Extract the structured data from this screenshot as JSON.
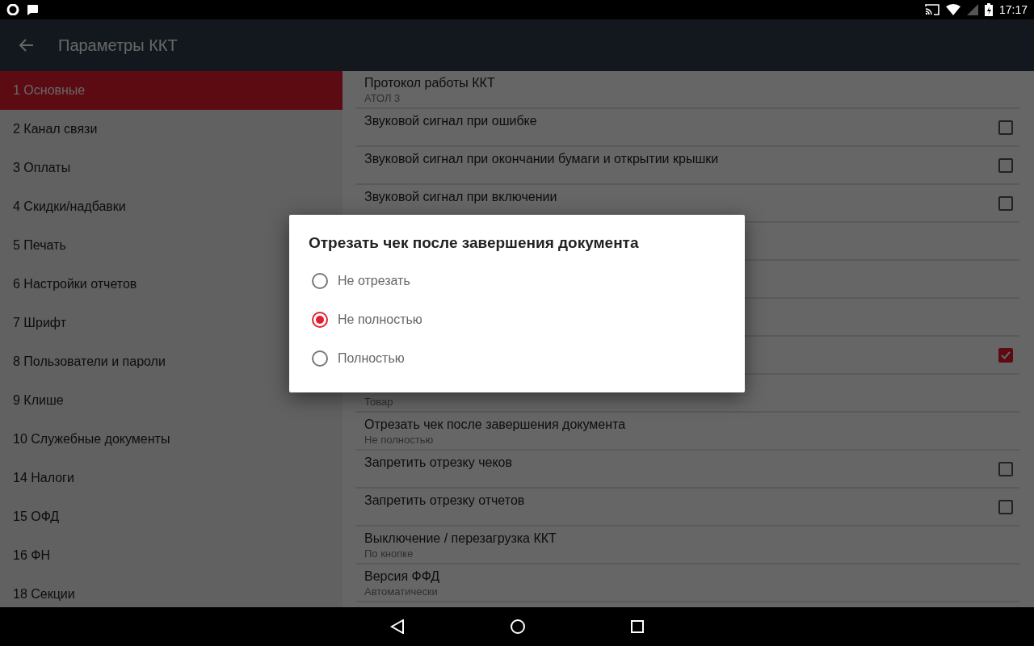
{
  "status_bar": {
    "time": "17:17"
  },
  "app_bar": {
    "title": "Параметры ККТ"
  },
  "sidebar": {
    "items": [
      {
        "label": "1 Основные",
        "selected": true
      },
      {
        "label": "2 Канал связи",
        "selected": false
      },
      {
        "label": "3 Оплаты",
        "selected": false
      },
      {
        "label": "4 Скидки/надбавки",
        "selected": false
      },
      {
        "label": "5 Печать",
        "selected": false
      },
      {
        "label": "6 Настройки отчетов",
        "selected": false
      },
      {
        "label": "7 Шрифт",
        "selected": false
      },
      {
        "label": "8 Пользователи и пароли",
        "selected": false
      },
      {
        "label": "9 Клише",
        "selected": false
      },
      {
        "label": "10 Служебные документы",
        "selected": false
      },
      {
        "label": "14 Налоги",
        "selected": false
      },
      {
        "label": "15 ОФД",
        "selected": false
      },
      {
        "label": "16 ФН",
        "selected": false
      },
      {
        "label": "18 Секции",
        "selected": false
      }
    ]
  },
  "settings": [
    {
      "kind": "value",
      "title": "Протокол работы ККТ",
      "value": "АТОЛ 3"
    },
    {
      "kind": "checkbox",
      "title": "Звуковой сигнал при ошибке",
      "checked": false
    },
    {
      "kind": "checkbox",
      "title": "Звуковой сигнал при окончании бумаги и открытии крышки",
      "checked": false
    },
    {
      "kind": "checkbox",
      "title": "Звуковой сигнал при включении",
      "checked": false
    },
    {
      "kind": "covered"
    },
    {
      "kind": "covered"
    },
    {
      "kind": "covered"
    },
    {
      "kind": "checkbox",
      "checked": true
    },
    {
      "kind": "value",
      "value": "Товар"
    },
    {
      "kind": "value",
      "title": "Отрезать чек после завершения документа",
      "value": "Не полностью"
    },
    {
      "kind": "checkbox",
      "title": "Запретить отрезку чеков",
      "checked": false
    },
    {
      "kind": "checkbox",
      "title": "Запретить отрезку отчетов",
      "checked": false
    },
    {
      "kind": "value",
      "title": "Выключение / перезагрузка ККТ",
      "value": "По кнопке"
    },
    {
      "kind": "value",
      "title": "Версия ФФД",
      "value": "Автоматически"
    }
  ],
  "dialog": {
    "title": "Отрезать чек после завершения документа",
    "options": [
      {
        "label": "Не отрезать",
        "selected": false
      },
      {
        "label": "Не полностью",
        "selected": true
      },
      {
        "label": "Полностью",
        "selected": false
      }
    ]
  }
}
